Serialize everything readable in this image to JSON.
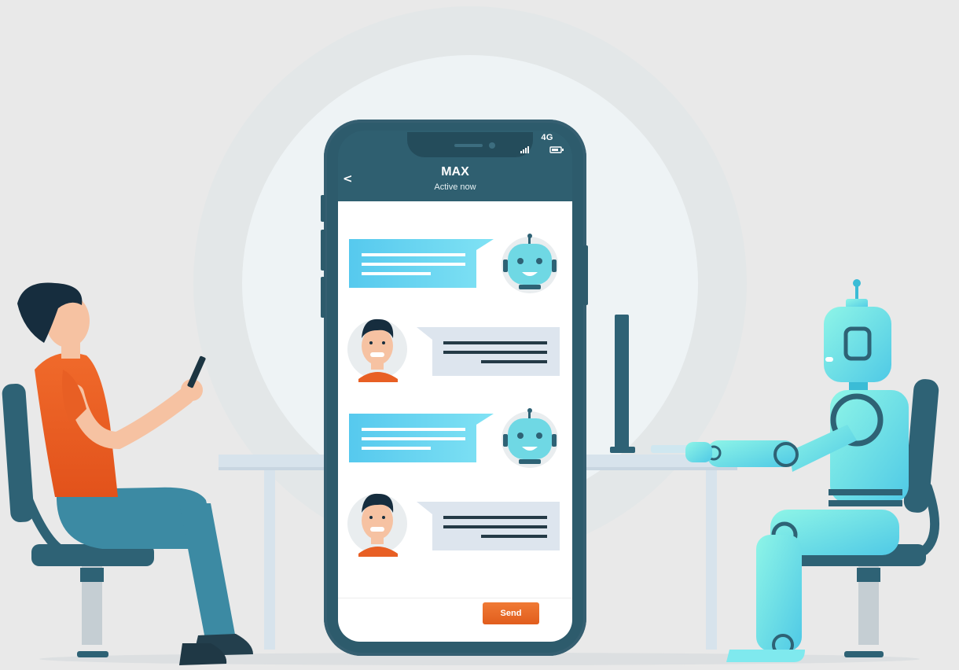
{
  "chat": {
    "contact_name": "MAX",
    "contact_status": "Active now",
    "status_bar": "4G",
    "send_label": "Send"
  },
  "icons": {
    "back": "chevron-left-icon",
    "signal": "signal-icon",
    "battery": "battery-icon"
  },
  "colors": {
    "background": "#e9e9e9",
    "phone_frame": "#2d5b6c",
    "bot_bubble": "#5fd0ef",
    "user_bubble": "#dde5ee",
    "send_button": "#e8672a",
    "shirt": "#e85f24",
    "pants": "#3c8aa3",
    "robot": "#6ee6e0"
  }
}
